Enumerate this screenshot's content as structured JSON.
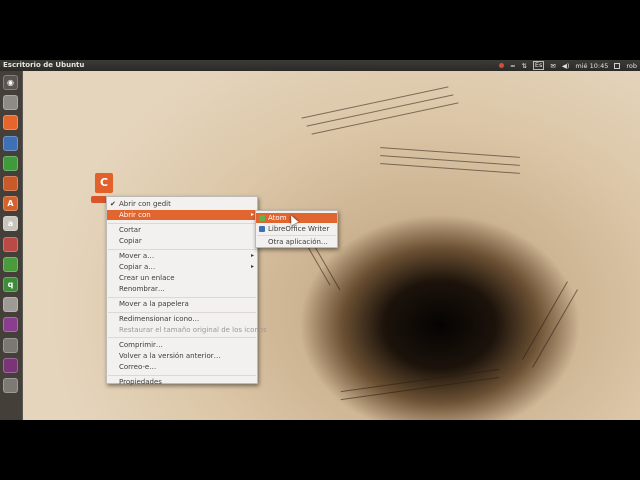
{
  "topbar": {
    "title": "Escritorio de Ubuntu",
    "keyboard": "Es",
    "time": "mié 10:45",
    "user": "rob"
  },
  "launcher": {
    "items": [
      {
        "name": "dash-icon",
        "glyph": "◉",
        "color": "#5a5550"
      },
      {
        "name": "files-icon",
        "glyph": "",
        "color": "#8e8a86"
      },
      {
        "name": "firefox-icon",
        "glyph": "",
        "color": "#e5662c"
      },
      {
        "name": "writer-icon",
        "glyph": "",
        "color": "#3f6fb5"
      },
      {
        "name": "calc-icon",
        "glyph": "",
        "color": "#3f9a3c"
      },
      {
        "name": "impress-icon",
        "glyph": "",
        "color": "#c85a2a"
      },
      {
        "name": "software-center-icon",
        "glyph": "A",
        "color": "#d4622c"
      },
      {
        "name": "amazon-icon",
        "glyph": "a",
        "color": "#c9c4bc"
      },
      {
        "name": "settings-icon",
        "glyph": "",
        "color": "#b94a45"
      },
      {
        "name": "green-app-icon",
        "glyph": "",
        "color": "#4a9b3c"
      },
      {
        "name": "qbittorrent-icon",
        "glyph": "q",
        "color": "#3d8c3a"
      },
      {
        "name": "drive-icon",
        "glyph": "",
        "color": "#9e9a96"
      },
      {
        "name": "purple-app-icon",
        "glyph": "",
        "color": "#8a3e8e"
      },
      {
        "name": "disk-icon",
        "glyph": "",
        "color": "#7b7772"
      },
      {
        "name": "terminal-icon",
        "glyph": "",
        "color": "#7a3576"
      },
      {
        "name": "trash-icon",
        "glyph": "",
        "color": "#7d7974"
      }
    ]
  },
  "context_menu": {
    "items": [
      {
        "label": "Abrir con gedit",
        "check": "✔"
      },
      {
        "label": "Abrir con",
        "submenu": "▸",
        "highlight": true
      },
      {
        "sep": true
      },
      {
        "label": "Cortar"
      },
      {
        "label": "Copiar"
      },
      {
        "sep": true
      },
      {
        "label": "Mover a…",
        "submenu": "▸"
      },
      {
        "label": "Copiar a…",
        "submenu": "▸"
      },
      {
        "label": "Crear un enlace"
      },
      {
        "label": "Renombrar…"
      },
      {
        "sep": true
      },
      {
        "label": "Mover a la papelera"
      },
      {
        "sep": true
      },
      {
        "label": "Redimensionar icono…"
      },
      {
        "label": "Restaurar el tamaño original de los iconos",
        "disabled": true
      },
      {
        "sep": true
      },
      {
        "label": "Comprimir…"
      },
      {
        "label": "Volver a la versión anterior…"
      },
      {
        "label": "Correo-e…"
      },
      {
        "sep": true
      },
      {
        "label": "Propiedades"
      }
    ]
  },
  "submenu": {
    "items": [
      {
        "label": "Atom",
        "highlight": true,
        "color": "#66b24a"
      },
      {
        "label": "LibreOffice Writer",
        "color": "#3f6fb5"
      },
      {
        "sep": true
      },
      {
        "label": "Otra aplicación…"
      }
    ]
  },
  "desktop_icon": {
    "glyph": "C"
  }
}
